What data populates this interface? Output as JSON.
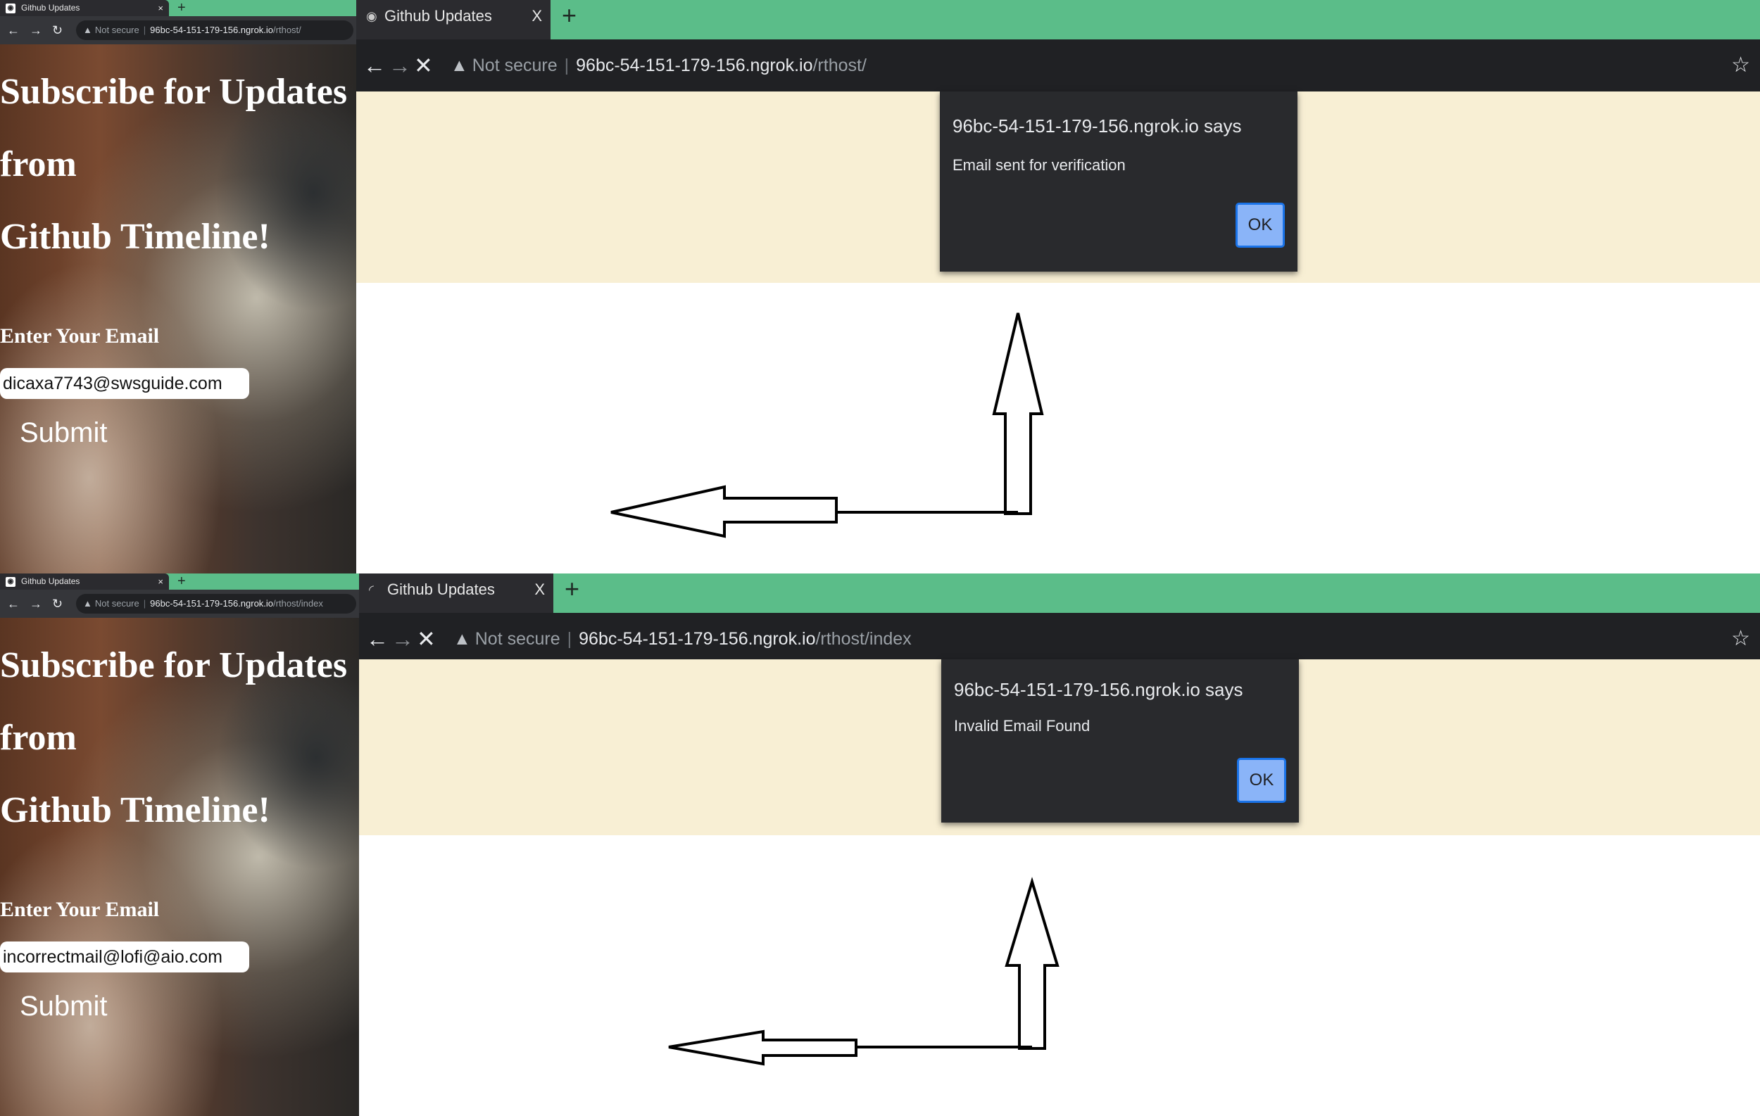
{
  "screens": [
    {
      "small": {
        "tab_title": "Github Updates",
        "favicon": "github-icon",
        "url_not_secure": "Not secure",
        "url_host": "96bc-54-151-179-156.ngrok.io",
        "url_path": "/rthost/",
        "heading_line1": "Subscribe for Updates",
        "heading_line2": "from",
        "heading_line3": "Github Timeline!",
        "email_label": "Enter Your Email",
        "email_value": "dicaxa7743@swsguide.com",
        "submit_label": "Submit"
      },
      "large": {
        "tab_title": "Github Updates",
        "url_not_secure": "Not secure",
        "url_host": "96bc-54-151-179-156.ngrok.io",
        "url_path": "/rthost/",
        "dialog_title": "96bc-54-151-179-156.ngrok.io says",
        "dialog_message": "Email sent for verification",
        "dialog_ok": "OK"
      }
    },
    {
      "small": {
        "tab_title": "Github Updates",
        "favicon": "github-icon",
        "url_not_secure": "Not secure",
        "url_host": "96bc-54-151-179-156.ngrok.io",
        "url_path": "/rthost/index",
        "heading_line1": "Subscribe for Updates",
        "heading_line2": "from",
        "heading_line3": "Github Timeline!",
        "email_label": "Enter Your Email",
        "email_value": "incorrectmail@lofi@aio.com",
        "submit_label": "Submit"
      },
      "large": {
        "tab_title": "Github Updates",
        "url_not_secure": "Not secure",
        "url_host": "96bc-54-151-179-156.ngrok.io",
        "url_path": "/rthost/index",
        "dialog_title": "96bc-54-151-179-156.ngrok.io says",
        "dialog_message": "Invalid Email Found",
        "dialog_ok": "OK"
      }
    }
  ],
  "colors": {
    "tab_strip": "#5bbd89",
    "page_banner": "#f8efd4",
    "dialog_bg": "#292a2d",
    "ok_button": "#8ab4f8"
  }
}
